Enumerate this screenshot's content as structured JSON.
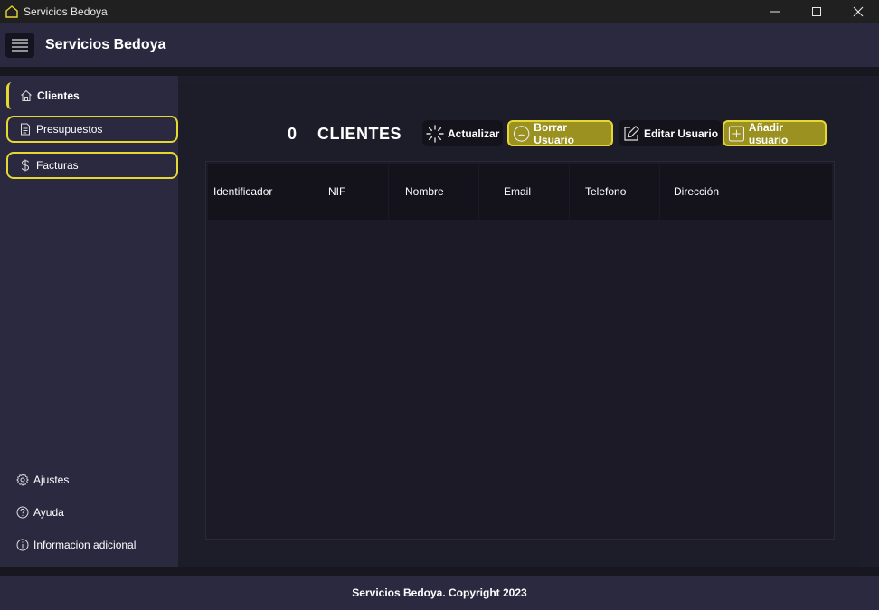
{
  "window": {
    "title": "Servicios Bedoya",
    "icon": "house-icon",
    "controls": [
      "minimize-icon",
      "maximize-icon",
      "close-icon"
    ]
  },
  "header": {
    "menu_icon": "hamburger-icon",
    "title": "Servicios Bedoya"
  },
  "sidebar": {
    "items": [
      {
        "label": "Clientes",
        "icon": "home-icon",
        "active": true
      },
      {
        "label": "Presupuestos",
        "icon": "document-icon"
      },
      {
        "label": "Facturas",
        "icon": "dollar-icon"
      }
    ],
    "bottom_items": [
      {
        "label": "Ajustes",
        "icon": "gear-icon"
      },
      {
        "label": "Ayuda",
        "icon": "help-icon"
      },
      {
        "label": "Informacion adicional",
        "icon": "info-icon"
      }
    ]
  },
  "main": {
    "count": "0",
    "heading": "CLIENTES",
    "toolbar": {
      "refresh_label": "Actualizar",
      "delete_label": "Borrar Usuario",
      "edit_label": "Editar Usuario",
      "add_label": "Añadir usuario"
    },
    "table": {
      "columns": [
        "Identificador",
        "NIF",
        "Nombre",
        "Email",
        "Telefono",
        "Dirección"
      ],
      "rows": []
    }
  },
  "footer": {
    "text": "Servicios Bedoya. Copyright 2023"
  },
  "colors": {
    "accent": "#e6d832",
    "accent_fill": "#9a9120",
    "panel": "#2b2940",
    "background": "#1e1d2b"
  }
}
